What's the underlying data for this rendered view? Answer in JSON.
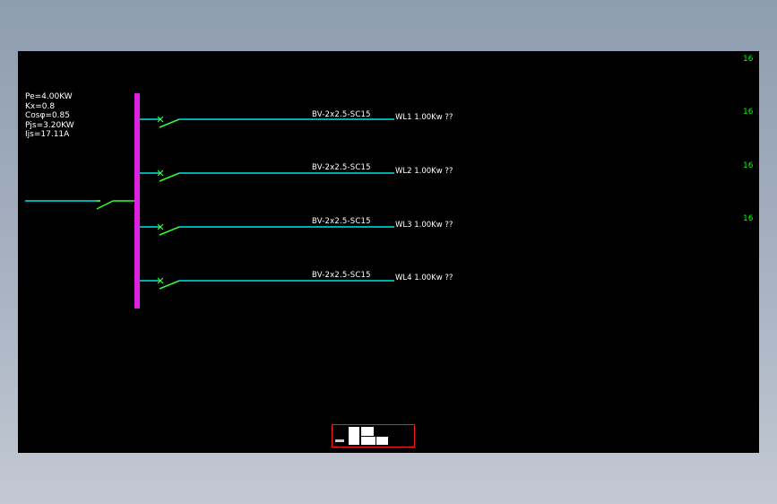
{
  "colors": {
    "bus": "#e020e0",
    "feeder": "#00e5e5",
    "switch": "#33ff33",
    "text": "#ffffff",
    "number": "#00ff00",
    "titleblock": "#ff1a1a"
  },
  "panel": {
    "params": [
      "Pe=4.00KW",
      "Kx=0.8",
      "Cosφ=0.85",
      "Pjs=3.20KW",
      "Ijs=17.11A"
    ]
  },
  "circuits": [
    {
      "cable": "BV-2x2.5-SC15",
      "label": "WL1 1.00Kw ??"
    },
    {
      "cable": "BV-2x2.5-SC15",
      "label": "WL2 1.00Kw ??"
    },
    {
      "cable": "BV-2x2.5-SC15",
      "label": "WL3 1.00Kw ??"
    },
    {
      "cable": "BV-2x2.5-SC15",
      "label": "WL4 1.00Kw ??"
    }
  ],
  "right_numbers": [
    "16",
    "16",
    "16",
    "16"
  ]
}
